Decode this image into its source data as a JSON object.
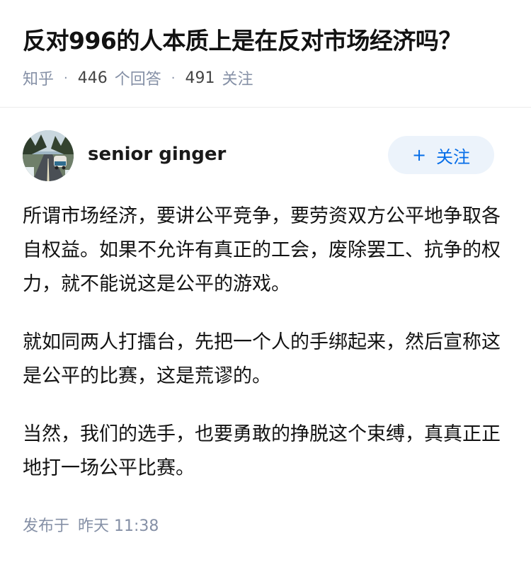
{
  "question": {
    "title": "反对996的人本质上是在反对市场经济吗？",
    "source": "知乎",
    "separator": "·",
    "answer_count": "446",
    "answer_label": "个回答",
    "follower_count": "491",
    "follower_label": "关注"
  },
  "answer": {
    "author_name": "senior ginger",
    "follow_button_label": "关注",
    "paragraphs": [
      "所谓市场经济，要讲公平竞争，要劳资双方公平地争取各自权益。如果不允许有真正的工会，废除罢工、抗争的权力，就不能说这是公平的游戏。",
      "就如同两人打擂台，先把一个人的手绑起来，然后宣称这是公平的比赛，这是荒谬的。",
      "当然，我们的选手，也要勇敢的挣脱这个束缚，真真正正地打一场公平比赛。"
    ],
    "published_label": "发布于",
    "published_time": "昨天 11:38"
  },
  "icons": {
    "plus": "plus-icon",
    "avatar": "avatar-road-van-image"
  },
  "colors": {
    "accent": "#056de8",
    "follow_bg": "#ecf3fb",
    "meta_text": "#8590a6",
    "text": "#121212"
  }
}
